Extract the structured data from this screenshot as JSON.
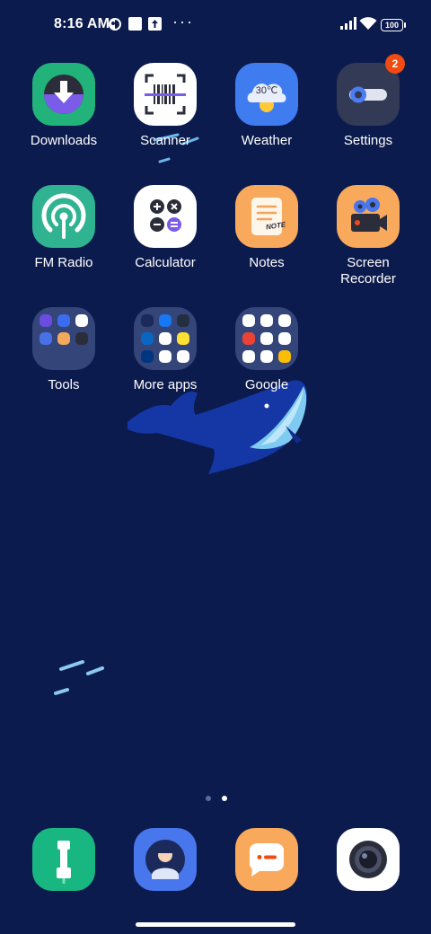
{
  "status_bar": {
    "time": "8:16 AM",
    "battery": "100",
    "icons": [
      "notification-app-icon",
      "square-notification-icon",
      "upload-icon",
      "more-dots-icon",
      "signal-icon",
      "wifi-icon",
      "battery-icon"
    ],
    "overflow": "···"
  },
  "apps": [
    {
      "label": "Downloads",
      "icon": "downloads-icon"
    },
    {
      "label": "Scanner",
      "icon": "barcode-scanner-icon"
    },
    {
      "label": "Weather",
      "icon": "weather-cloud-sun-icon",
      "temp": "30℃"
    },
    {
      "label": "Settings",
      "icon": "settings-toggle-icon",
      "badge": "2"
    },
    {
      "label": "FM Radio",
      "icon": "radio-antenna-icon"
    },
    {
      "label": "Calculator",
      "icon": "calculator-icon"
    },
    {
      "label": "Notes",
      "icon": "notes-icon",
      "tag": "NOTE"
    },
    {
      "label": "Screen\nRecorder",
      "label_line1": "Screen",
      "label_line2": "Recorder",
      "icon": "video-camera-icon"
    },
    {
      "label": "Tools",
      "icon": "folder-icon"
    },
    {
      "label": "More apps",
      "icon": "folder-icon"
    },
    {
      "label": "Google",
      "icon": "folder-icon"
    }
  ],
  "page_indicator": {
    "pages": 2,
    "current": 2
  },
  "dock": [
    {
      "icon": "phone-icon"
    },
    {
      "icon": "contacts-icon"
    },
    {
      "icon": "messages-icon"
    },
    {
      "icon": "camera-icon"
    }
  ],
  "colors": {
    "background": "#0c1b4d",
    "downloads": "#22b37a",
    "weather": "#3f7cf0",
    "settings": "#323a56",
    "radio": "#2fb391",
    "notes": "#f8a95b",
    "recorder": "#f8a95b",
    "badge": "#f04b12",
    "phone": "#18b681",
    "contacts": "#4876ec",
    "messages": "#f8a95b"
  }
}
